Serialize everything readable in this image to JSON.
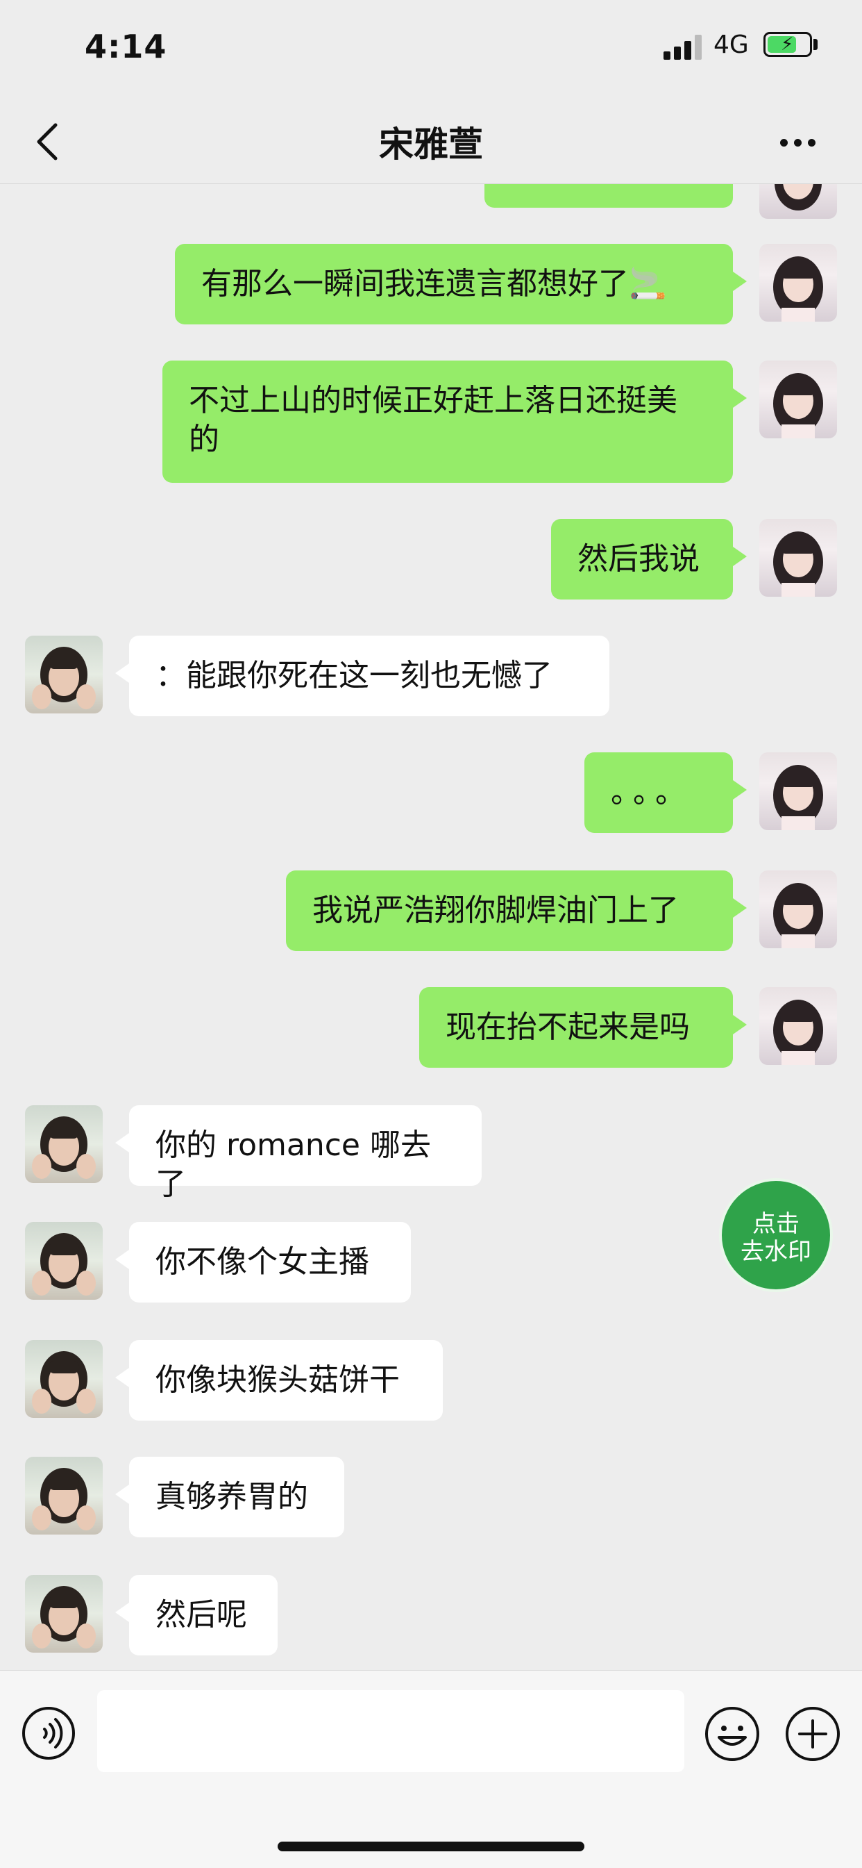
{
  "status_bar": {
    "time": "4:14",
    "network": "4G",
    "battery_level": 0.7,
    "battery_color": "#4cd964",
    "charging": true
  },
  "nav": {
    "back_icon": "chevron-left-icon",
    "title": "宋雅萱",
    "more_icon": "more-dots-icon"
  },
  "messages": [
    {
      "sender": "me",
      "text": ""
    },
    {
      "sender": "me",
      "text": "有那么一瞬间我连遗言都想好了🚬"
    },
    {
      "sender": "me",
      "text": "不过上山的时候正好赶上落日还挺美的"
    },
    {
      "sender": "me",
      "text": "然后我说"
    },
    {
      "sender": "them",
      "text": "：能跟你死在这一刻也无憾了"
    },
    {
      "sender": "me",
      "text": "。。。"
    },
    {
      "sender": "me",
      "text": "我说严浩翔你脚焊油门上了"
    },
    {
      "sender": "me",
      "text": "现在抬不起来是吗"
    },
    {
      "sender": "them",
      "text": "你的 romance 哪去了"
    },
    {
      "sender": "them",
      "text": "你不像个女主播"
    },
    {
      "sender": "them",
      "text": "你像块猴头菇饼干"
    },
    {
      "sender": "them",
      "text": "真够养胃的"
    },
    {
      "sender": "them",
      "text": "然后呢"
    }
  ],
  "floating_button": {
    "line1": "点击",
    "line2": "去水印"
  },
  "input_bar": {
    "voice_icon": "voice-icon",
    "input_value": "",
    "emoji_icon": "emoji-icon",
    "plus_icon": "plus-icon"
  },
  "colors": {
    "my_bubble": "#95ec69",
    "their_bubble": "#ffffff",
    "background": "#ededed",
    "float_button": "#2fa34a"
  }
}
